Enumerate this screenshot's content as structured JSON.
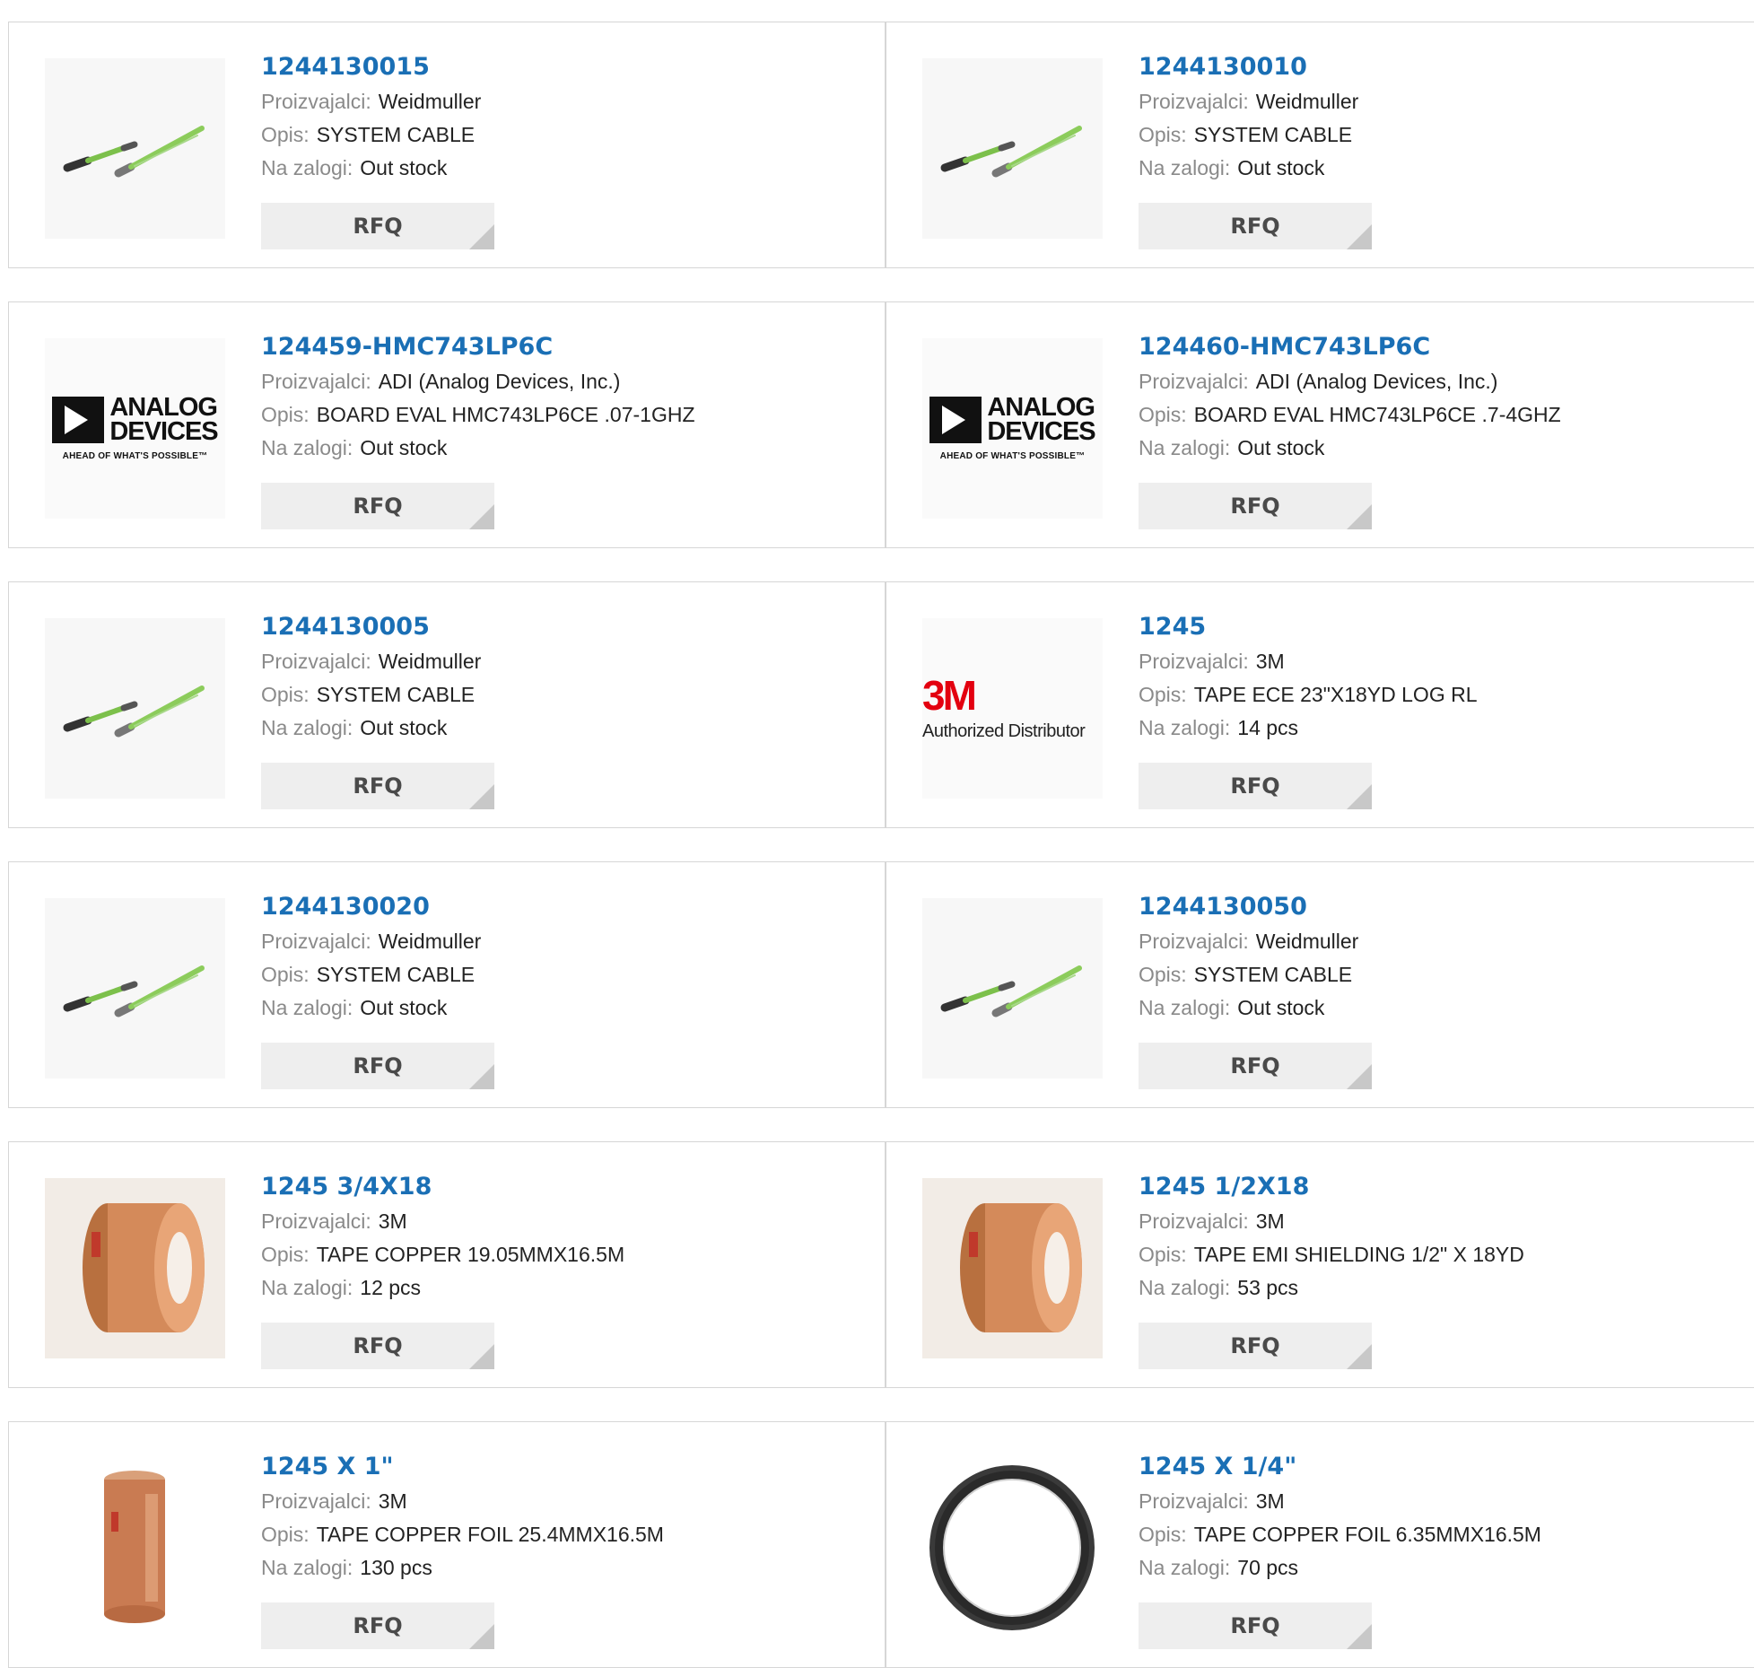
{
  "labels": {
    "manufacturer": "Proizvajalci:",
    "description": "Opis:",
    "stock": "Na zalogi:",
    "rfq": "RFQ"
  },
  "products": [
    {
      "part": "1244130015",
      "manufacturer": "Weidmuller",
      "description": "SYSTEM CABLE",
      "stock": "Out stock",
      "image": "cable-image"
    },
    {
      "part": "1244130010",
      "manufacturer": "Weidmuller",
      "description": "SYSTEM CABLE",
      "stock": "Out stock",
      "image": "cable-image"
    },
    {
      "part": "124459-HMC743LP6C",
      "manufacturer": "ADI (Analog Devices, Inc.)",
      "description": "BOARD EVAL HMC743LP6CE .07-1GHZ",
      "stock": "Out stock",
      "image": "analog-devices-logo"
    },
    {
      "part": "124460-HMC743LP6C",
      "manufacturer": "ADI (Analog Devices, Inc.)",
      "description": "BOARD EVAL HMC743LP6CE .7-4GHZ",
      "stock": "Out stock",
      "image": "analog-devices-logo"
    },
    {
      "part": "1244130005",
      "manufacturer": "Weidmuller",
      "description": "SYSTEM CABLE",
      "stock": "Out stock",
      "image": "cable-image"
    },
    {
      "part": "1245",
      "manufacturer": "3M",
      "description": "TAPE ECE 23\"X18YD LOG RL",
      "stock": "14 pcs",
      "image": "3m-logo"
    },
    {
      "part": "1244130020",
      "manufacturer": "Weidmuller",
      "description": "SYSTEM CABLE",
      "stock": "Out stock",
      "image": "cable-image"
    },
    {
      "part": "1244130050",
      "manufacturer": "Weidmuller",
      "description": "SYSTEM CABLE",
      "stock": "Out stock",
      "image": "cable-image"
    },
    {
      "part": "1245 3/4X18",
      "manufacturer": "3M",
      "description": "TAPE COPPER 19.05MMX16.5M",
      "stock": "12 pcs",
      "image": "copper-tape-image"
    },
    {
      "part": "1245 1/2X18",
      "manufacturer": "3M",
      "description": "TAPE EMI SHIELDING 1/2\" X 18YD",
      "stock": "53 pcs",
      "image": "copper-tape-image"
    },
    {
      "part": "1245 X 1\"",
      "manufacturer": "3M",
      "description": "TAPE COPPER FOIL 25.4MMX16.5M",
      "stock": "130 pcs",
      "image": "copper-tape-side-image"
    },
    {
      "part": "1245 X 1/4\"",
      "manufacturer": "3M",
      "description": "TAPE COPPER FOIL 6.35MMX16.5M",
      "stock": "70 pcs",
      "image": "black-tape-roll-image"
    }
  ],
  "logos": {
    "adi_line1": "ANALOG",
    "adi_line2": "DEVICES",
    "adi_tagline": "AHEAD OF WHAT'S POSSIBLE™",
    "mmm_mark": "3M",
    "mmm_sub": "Authorized Distributor"
  },
  "colors": {
    "part_link": "#1a6fb5",
    "label": "#8a8a8a",
    "rfq_bg": "#eeeeee",
    "border": "#d6d6d6",
    "cable_green": "#7cc04b",
    "copper": "#c87a4a",
    "mmm_red": "#e3000f"
  }
}
